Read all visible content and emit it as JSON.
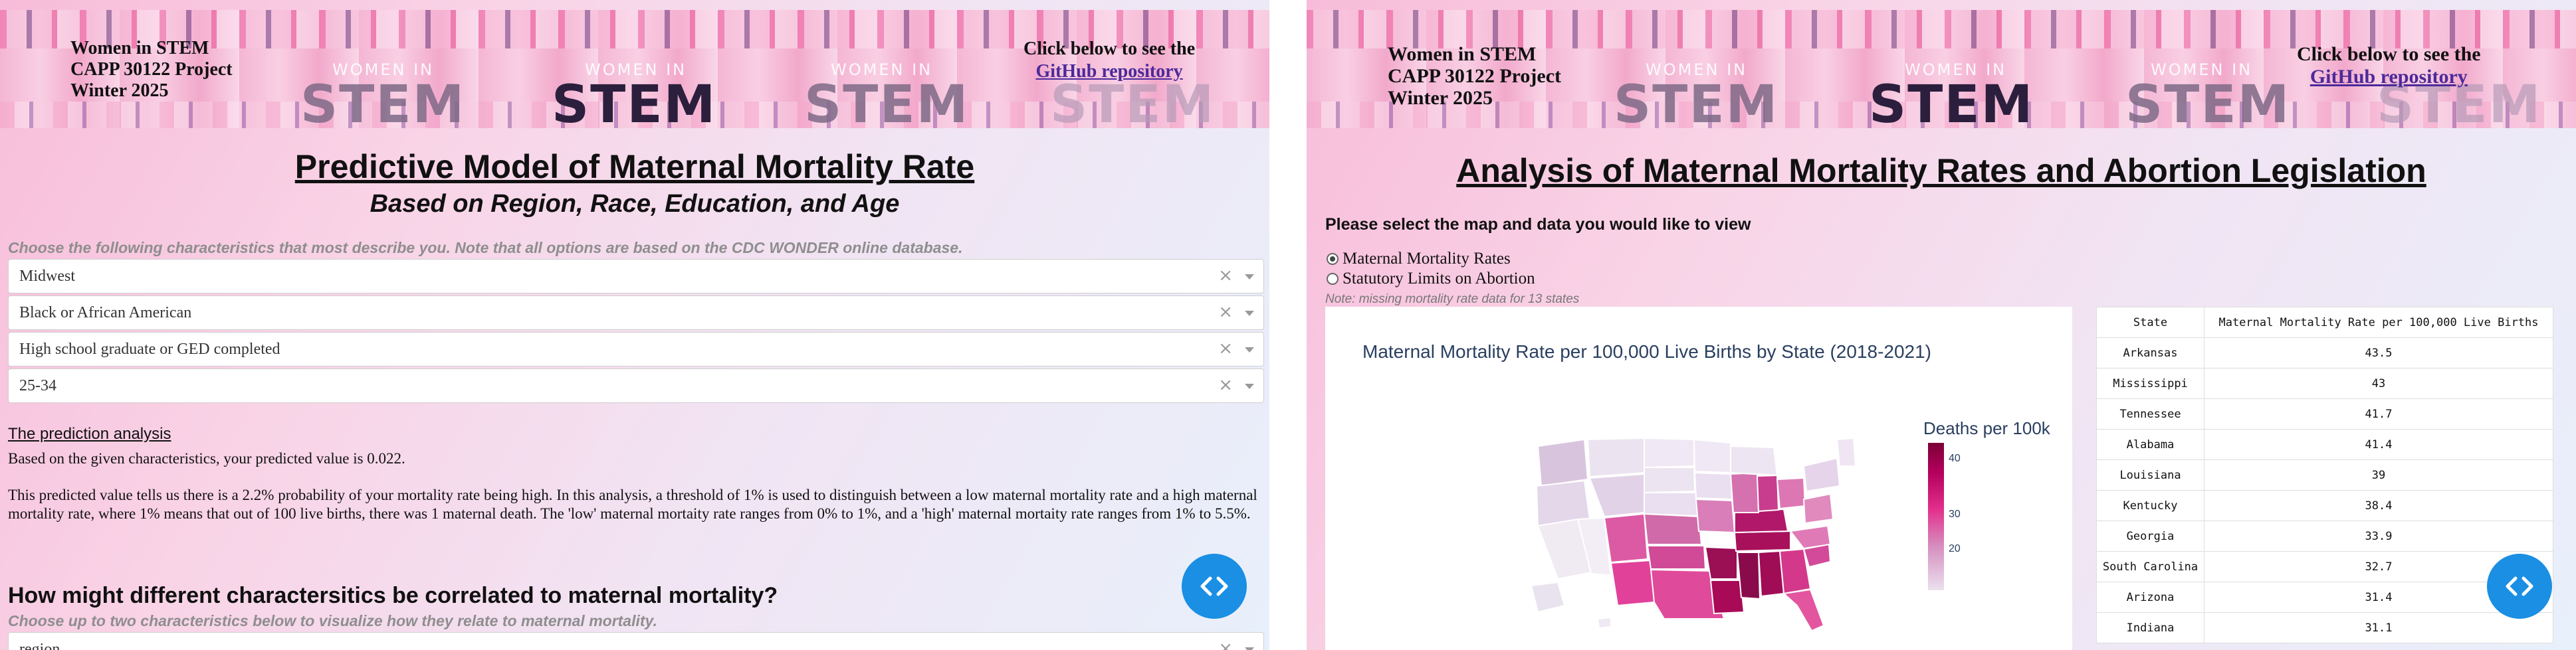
{
  "banner": {
    "line1": "Women in STEM",
    "line2": "CAPP 30122 Project",
    "line3": "Winter 2025",
    "repo_prompt": "Click below to see the",
    "repo_link": "GitHub repository",
    "art_word": "STEM",
    "art_prefix": "WOMEN IN"
  },
  "left": {
    "title": "Predictive Model of Maternal Mortality Rate",
    "subtitle": "Based on Region, Race, Education, and Age",
    "instructions": "Choose the following characteristics that most describe you. Note that all options are based on the CDC WONDER online database.",
    "dropdowns": [
      {
        "value": "Midwest"
      },
      {
        "value": "Black or African American"
      },
      {
        "value": "High school graduate or GED completed"
      },
      {
        "value": "25-34"
      }
    ],
    "clear_symbol": "×",
    "analysis_title": "The prediction analysis",
    "analysis_p1": "Based on the given characteristics, your predicted value is 0.022.",
    "analysis_p2": "This predicted value tells us there is a 2.2% probability of your mortality rate being high. In this analysis, a threshold of 1% is used to distinguish between a low maternal mortality rate and a high maternal mortality rate, where 1% means that out of 100 live births, there was 1 maternal death. The 'low' maternal mortaity rate ranges from 0% to 1%, and a 'high' maternal mortaity rate ranges from 1% to 5.5%.",
    "section_title": "How might different charactersitics be correlated to maternal mortality?",
    "section_hint": "Choose up to two characteristics below to visualize how they relate to maternal mortality.",
    "partial_dropdown": "region"
  },
  "right": {
    "title": "Analysis of Maternal Mortality Rates and Abortion Legislation",
    "prompt": "Please select the map and data you would like to view",
    "radio_options": [
      "Maternal Mortality Rates",
      "Statutory Limits on Abortion"
    ],
    "selected_radio": "Maternal Mortality Rates",
    "note": "Note: missing mortality rate data for 13 states",
    "map_title": "Maternal Mortality Rate per 100,000 Live Births by State (2018-2021)",
    "legend_title": "Deaths per 100k",
    "legend_ticks": [
      "40",
      "30",
      "20"
    ],
    "table": {
      "headers": [
        "State",
        "Maternal Mortality Rate per 100,000 Live Births"
      ],
      "rows": [
        [
          "Arkansas",
          "43.5"
        ],
        [
          "Mississippi",
          "43"
        ],
        [
          "Tennessee",
          "41.7"
        ],
        [
          "Alabama",
          "41.4"
        ],
        [
          "Louisiana",
          "39"
        ],
        [
          "Kentucky",
          "38.4"
        ],
        [
          "Georgia",
          "33.9"
        ],
        [
          "South Carolina",
          "32.7"
        ],
        [
          "Arizona",
          "31.4"
        ],
        [
          "Indiana",
          "31.1"
        ]
      ]
    }
  },
  "colors": {
    "fab": "#1a8fe3",
    "link": "#4b2a9a",
    "map_dark": "#7b0036",
    "map_light": "#ebe1ee"
  }
}
